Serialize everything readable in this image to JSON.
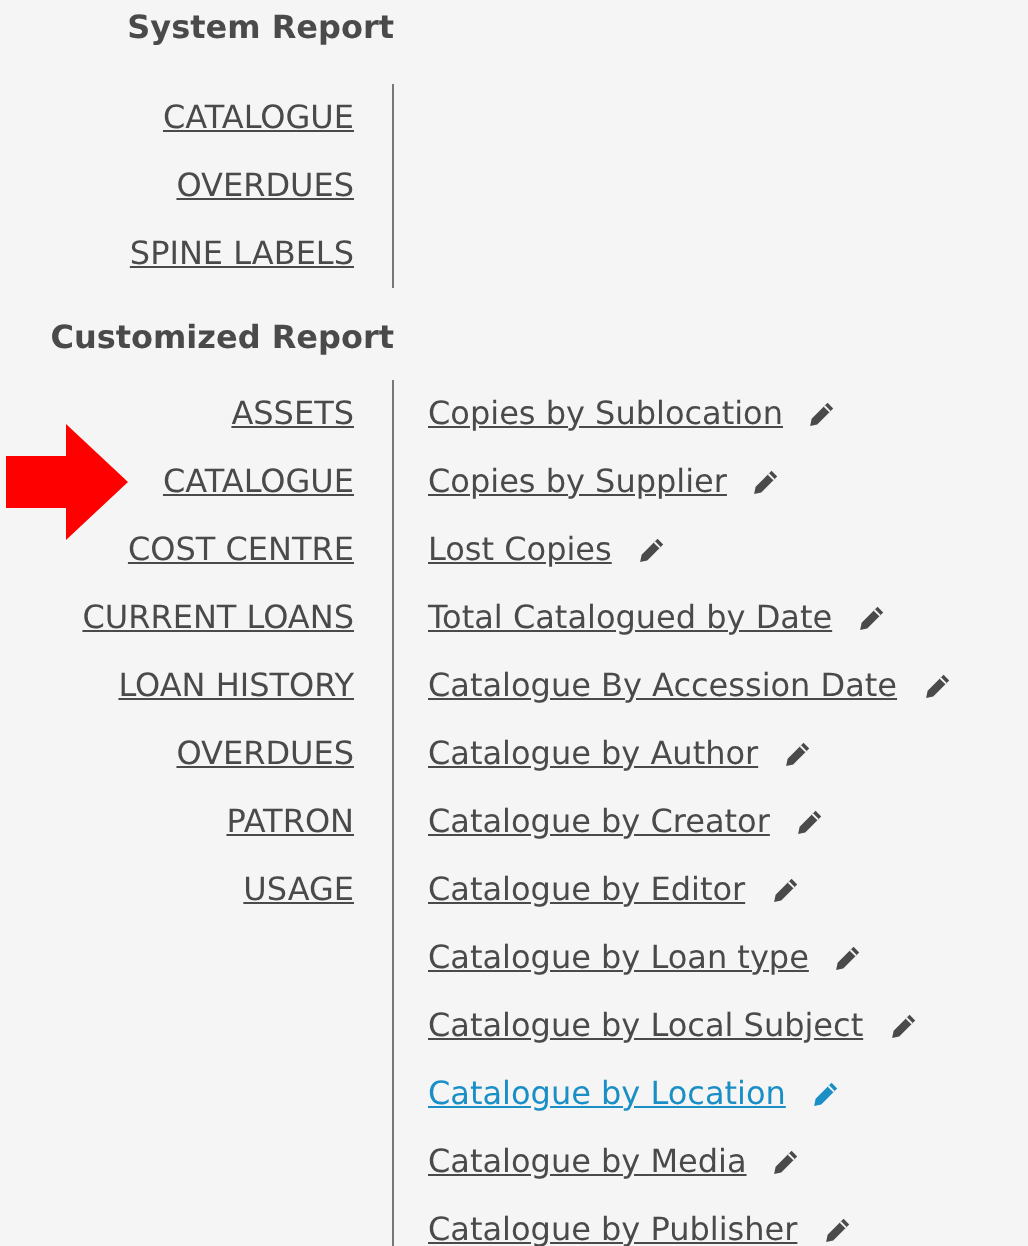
{
  "system_report": {
    "title": "System Report",
    "items": [
      {
        "label": "CATALOGUE"
      },
      {
        "label": "OVERDUES"
      },
      {
        "label": "SPINE LABELS"
      }
    ]
  },
  "customized_report": {
    "title": "Customized Report",
    "categories": [
      {
        "label": "ASSETS",
        "pointed_at": false
      },
      {
        "label": "CATALOGUE",
        "pointed_at": true
      },
      {
        "label": "COST CENTRE",
        "pointed_at": false
      },
      {
        "label": "CURRENT LOANS",
        "pointed_at": false
      },
      {
        "label": "LOAN HISTORY",
        "pointed_at": false
      },
      {
        "label": "OVERDUES",
        "pointed_at": false
      },
      {
        "label": "PATRON",
        "pointed_at": false
      },
      {
        "label": "USAGE",
        "pointed_at": false
      }
    ],
    "reports": [
      {
        "label": "Copies by Sublocation",
        "selected": false
      },
      {
        "label": "Copies by Supplier",
        "selected": false
      },
      {
        "label": "Lost Copies",
        "selected": false
      },
      {
        "label": "Total Catalogued by Date",
        "selected": false
      },
      {
        "label": "Catalogue By Accession Date",
        "selected": false
      },
      {
        "label": "Catalogue by Author",
        "selected": false
      },
      {
        "label": "Catalogue by Creator",
        "selected": false
      },
      {
        "label": "Catalogue by Editor",
        "selected": false
      },
      {
        "label": "Catalogue by Loan type",
        "selected": false
      },
      {
        "label": "Catalogue by Local Subject",
        "selected": false
      },
      {
        "label": "Catalogue by Location",
        "selected": true
      },
      {
        "label": "Catalogue by Media",
        "selected": false
      },
      {
        "label": "Catalogue by Publisher",
        "selected": false
      }
    ]
  }
}
